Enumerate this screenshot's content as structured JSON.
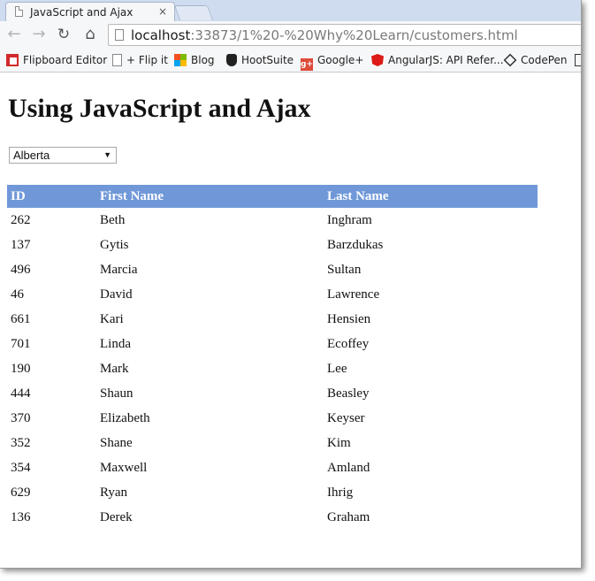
{
  "browser": {
    "tab_title": "JavaScript and Ajax",
    "tab_close": "×",
    "url_host": "localhost",
    "url_rest": ":33873/1%20-%20Why%20Learn/customers.html"
  },
  "bookmarks": [
    {
      "label": "Flipboard Editor",
      "icon": "flipboard-icon"
    },
    {
      "label": "+ Flip it",
      "icon": "page-icon"
    },
    {
      "label": "Blog",
      "icon": "windows-icon"
    },
    {
      "label": "HootSuite",
      "icon": "owl-icon"
    },
    {
      "label": "Google+",
      "icon": "google-plus-icon"
    },
    {
      "label": "AngularJS: API Refer...",
      "icon": "angular-icon"
    },
    {
      "label": "CodePen",
      "icon": "codepen-icon"
    }
  ],
  "page": {
    "title": "Using JavaScript and Ajax",
    "province_select": "Alberta"
  },
  "table": {
    "headers": [
      "ID",
      "First Name",
      "Last Name"
    ],
    "header_color": "#7098d8",
    "rows": [
      [
        "262",
        "Beth",
        "Inghram"
      ],
      [
        "137",
        "Gytis",
        "Barzdukas"
      ],
      [
        "496",
        "Marcia",
        "Sultan"
      ],
      [
        "46",
        "David",
        "Lawrence"
      ],
      [
        "661",
        "Kari",
        "Hensien"
      ],
      [
        "701",
        "Linda",
        "Ecoffey"
      ],
      [
        "190",
        "Mark",
        "Lee"
      ],
      [
        "444",
        "Shaun",
        "Beasley"
      ],
      [
        "370",
        "Elizabeth",
        "Keyser"
      ],
      [
        "352",
        "Shane",
        "Kim"
      ],
      [
        "354",
        "Maxwell",
        "Amland"
      ],
      [
        "629",
        "Ryan",
        "Ihrig"
      ],
      [
        "136",
        "Derek",
        "Graham"
      ]
    ]
  }
}
